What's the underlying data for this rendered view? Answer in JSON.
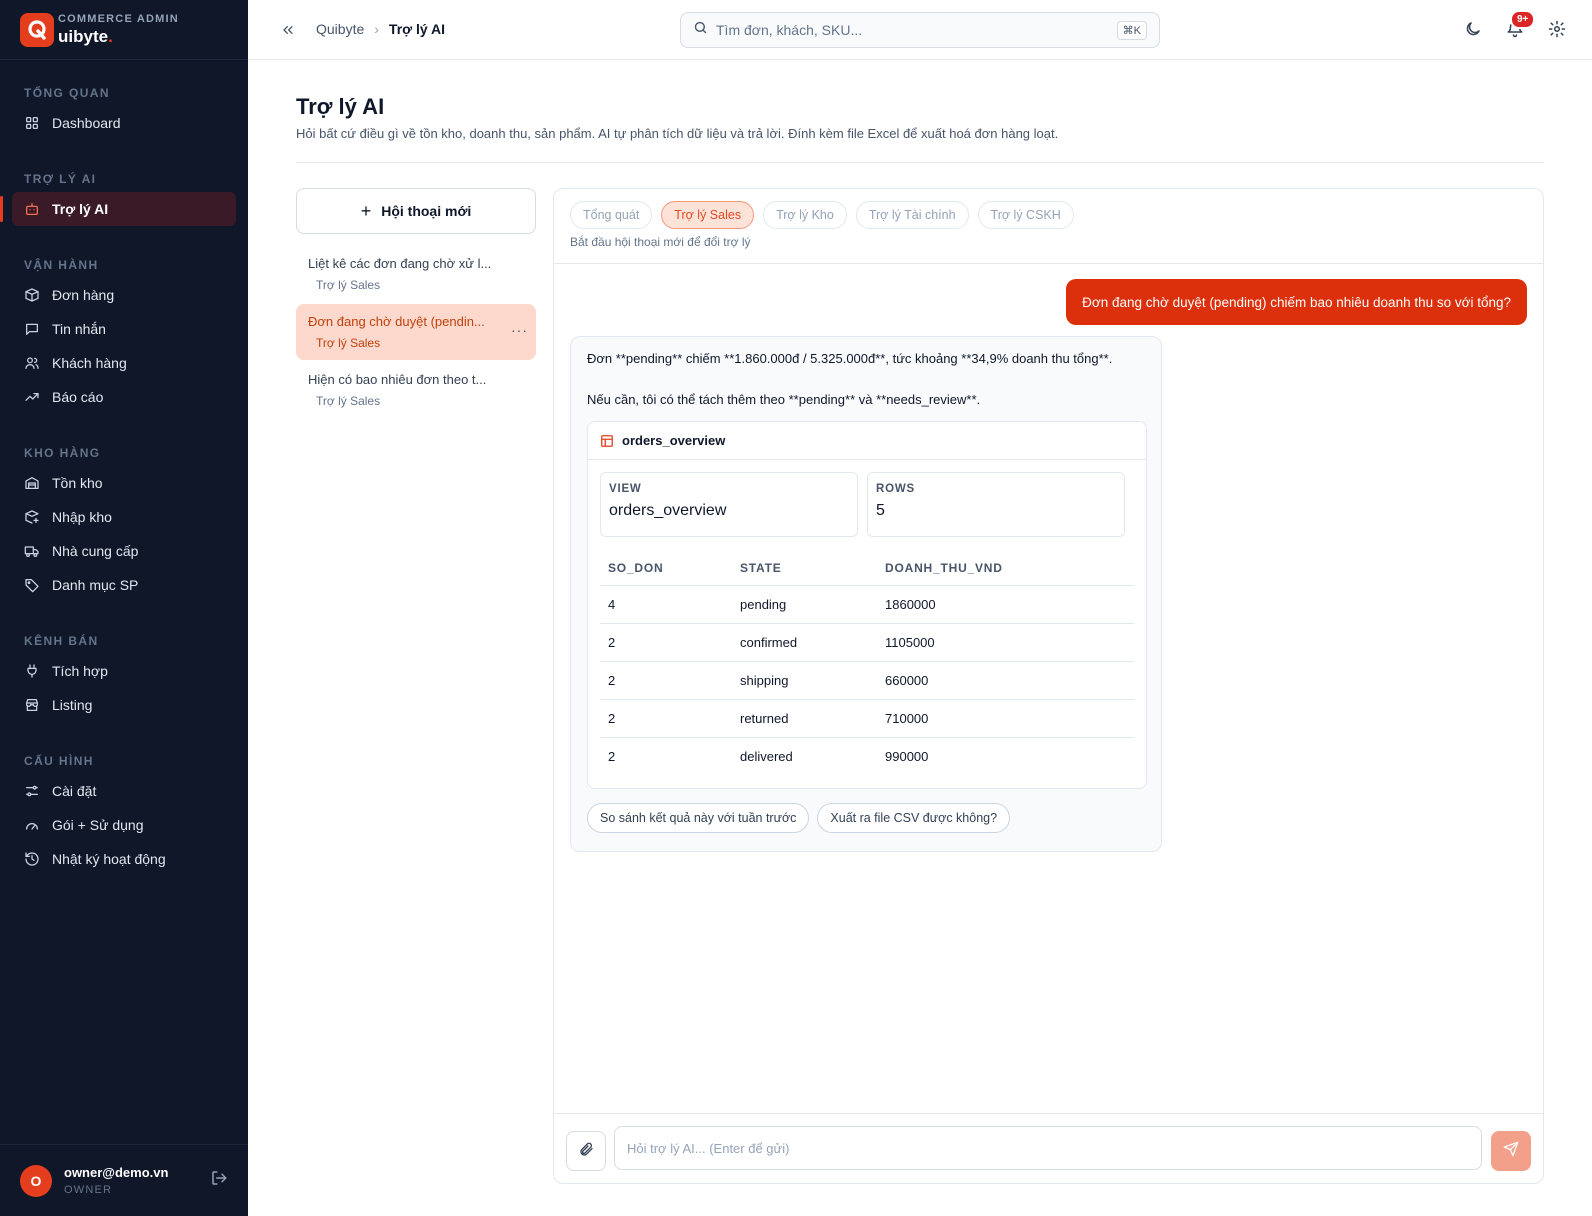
{
  "brand": {
    "subtitle": "COMMERCE ADMIN",
    "name": "uibyte",
    "dot": ".",
    "logo_letter": "Q"
  },
  "sidebar": {
    "sections": [
      {
        "title": "TỔNG QUAN",
        "items": [
          {
            "label": "Dashboard",
            "icon": "grid-icon"
          }
        ]
      },
      {
        "title": "TRỢ LÝ AI",
        "items": [
          {
            "label": "Trợ lý AI",
            "icon": "robot-icon",
            "active": true
          }
        ]
      },
      {
        "title": "VẬN HÀNH",
        "items": [
          {
            "label": "Đơn hàng",
            "icon": "box-icon"
          },
          {
            "label": "Tin nhắn",
            "icon": "message-icon"
          },
          {
            "label": "Khách hàng",
            "icon": "users-icon"
          },
          {
            "label": "Báo cáo",
            "icon": "trend-icon"
          }
        ]
      },
      {
        "title": "KHO HÀNG",
        "items": [
          {
            "label": "Tồn kho",
            "icon": "warehouse-icon"
          },
          {
            "label": "Nhập kho",
            "icon": "package-plus-icon"
          },
          {
            "label": "Nhà cung cấp",
            "icon": "truck-icon"
          },
          {
            "label": "Danh mục SP",
            "icon": "tag-icon"
          }
        ]
      },
      {
        "title": "KÊNH BÁN",
        "items": [
          {
            "label": "Tích hợp",
            "icon": "plug-icon"
          },
          {
            "label": "Listing",
            "icon": "store-icon"
          }
        ]
      },
      {
        "title": "CẤU HÌNH",
        "items": [
          {
            "label": "Cài đặt",
            "icon": "sliders-icon"
          },
          {
            "label": "Gói + Sử dụng",
            "icon": "gauge-icon"
          },
          {
            "label": "Nhật ký hoạt động",
            "icon": "history-icon"
          }
        ]
      }
    ]
  },
  "user": {
    "initial": "O",
    "email": "owner@demo.vn",
    "role": "OWNER"
  },
  "topbar": {
    "breadcrumb": [
      "Quibyte",
      "Trợ lý AI"
    ],
    "search_placeholder": "Tìm đơn, khách, SKU...",
    "search_shortcut": "⌘K",
    "notif_badge": "9+"
  },
  "page": {
    "title": "Trợ lý AI",
    "description": "Hỏi bất cứ điều gì về tồn kho, doanh thu, sản phẩm. AI tự phân tích dữ liệu và trả lời. Đính kèm file Excel để xuất hoá đơn hàng loạt."
  },
  "conversations": {
    "new_label": "Hội thoại mới",
    "items": [
      {
        "title": "Liệt kê các đơn đang chờ xử l...",
        "assistant": "Trợ lý Sales"
      },
      {
        "title": "Đơn đang chờ duyệt (pendin...",
        "assistant": "Trợ lý Sales",
        "active": true,
        "more": "···"
      },
      {
        "title": "Hiện có bao nhiêu đơn theo t...",
        "assistant": "Trợ lý Sales"
      }
    ]
  },
  "chat": {
    "assistants": [
      "Tổng quát",
      "Trợ lý Sales",
      "Trợ lý Kho",
      "Trợ lý Tài chính",
      "Trợ lý CSKH"
    ],
    "active_assistant": 1,
    "hint": "Bắt đầu hội thoại mới để đổi trợ lý",
    "user_message": "Đơn đang chờ duyệt (pending) chiếm bao nhiêu doanh thu so với tổng?",
    "ai_line1": "Đơn **pending** chiếm **1.860.000đ / 5.325.000đ**, tức khoảng **34,9% doanh thu tổng**.",
    "ai_line2": "Nếu cần, tôi có thể tách thêm theo **pending** và **needs_review**.",
    "tool": {
      "name": "orders_overview",
      "kpis": [
        {
          "label": "VIEW",
          "value": "orders_overview"
        },
        {
          "label": "ROWS",
          "value": "5"
        }
      ],
      "columns": [
        "SO_DON",
        "STATE",
        "DOANH_THU_VND"
      ],
      "rows": [
        [
          "4",
          "pending",
          "1860000"
        ],
        [
          "2",
          "confirmed",
          "1105000"
        ],
        [
          "2",
          "shipping",
          "660000"
        ],
        [
          "2",
          "returned",
          "710000"
        ],
        [
          "2",
          "delivered",
          "990000"
        ]
      ]
    },
    "suggestions": [
      "So sánh kết quả này với tuần trước",
      "Xuất ra file CSV được không?"
    ],
    "input_placeholder": "Hỏi trợ lý AI...  (Enter để gửi)"
  },
  "colors": {
    "accent": "#dc2f0c",
    "sidebar_bg": "#0f1729",
    "active_conv": "#fcd9cc"
  }
}
